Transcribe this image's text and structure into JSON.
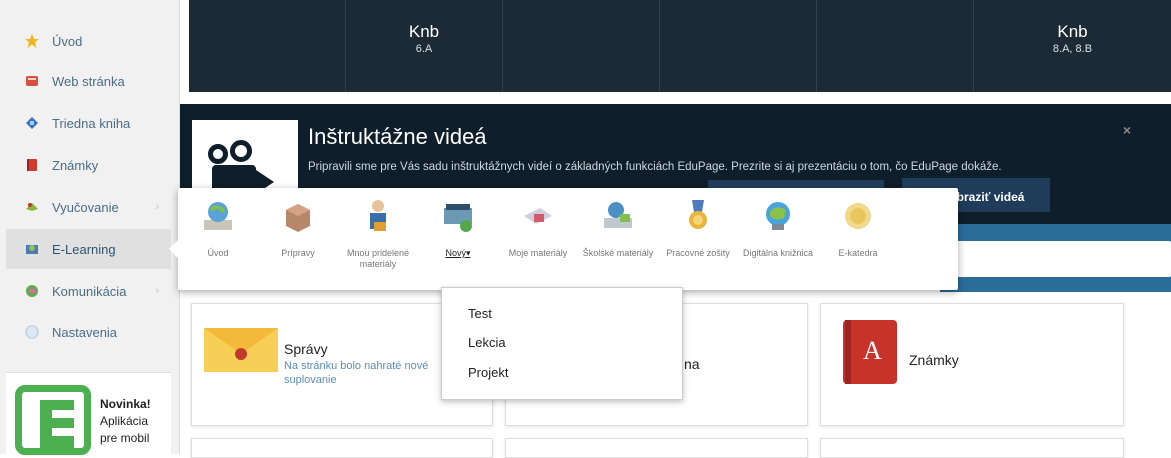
{
  "sidebar": {
    "items": [
      {
        "label": "Úvod",
        "icon": "star-icon",
        "color": "#f2b51c"
      },
      {
        "label": "Web stránka",
        "icon": "web-icon",
        "color": "#d7503c"
      },
      {
        "label": "Triedna kniha",
        "icon": "class-book-icon",
        "color": "#3c6fc0"
      },
      {
        "label": "Známky",
        "icon": "grades-book-icon",
        "color": "#d13a2f"
      },
      {
        "label": "Vyučovanie",
        "icon": "teaching-icon",
        "color": "#8ab53e"
      },
      {
        "label": "E-Learning",
        "icon": "elearning-icon",
        "color": "#4b7bb3"
      },
      {
        "label": "Komunikácia",
        "icon": "communication-icon",
        "color": "#6aa84f"
      },
      {
        "label": "Nastavenia",
        "icon": "settings-icon",
        "color": "#bcd4e6"
      }
    ],
    "novinka": {
      "title": "Novinka!",
      "line2": "Aplikácia",
      "line3": "pre mobil",
      "brand_color": "#4caf50"
    }
  },
  "timetable": {
    "cells": [
      {
        "name": "",
        "class": ""
      },
      {
        "name": "Knb",
        "class": "6.A"
      },
      {
        "name": "",
        "class": ""
      },
      {
        "name": "",
        "class": ""
      },
      {
        "name": "",
        "class": ""
      },
      {
        "name": "Knb",
        "class": "8.A, 8.B"
      }
    ]
  },
  "banner": {
    "title": "Inštruktážne videá",
    "description": "Pripravili sme pre Vás sadu inštruktážnych videí o základných funkciách EduPage. Prezrite si aj prezentáciu o tom, čo EduPage dokáže.",
    "close": "×",
    "button_videos": "Zobraziť videá"
  },
  "elearning_menu": {
    "items": [
      {
        "label": "Úvod",
        "icon": "globe-book-icon"
      },
      {
        "label": "Prípravy",
        "icon": "box-icon"
      },
      {
        "label": "Mnou pridelené materiály",
        "icon": "teacher-icon"
      },
      {
        "label": "Nový▾",
        "icon": "new-material-icon"
      },
      {
        "label": "Moje materiály",
        "icon": "materials-icon"
      },
      {
        "label": "Školské materiály",
        "icon": "school-materials-icon"
      },
      {
        "label": "Pracovné zošity",
        "icon": "medal-icon"
      },
      {
        "label": "Digitálna knižnica",
        "icon": "digital-library-icon"
      },
      {
        "label": "E-katedra",
        "icon": "coin-icon"
      }
    ],
    "dropdown": [
      "Test",
      "Lekcia",
      "Projekt"
    ]
  },
  "cards": {
    "spravy": {
      "title": "Správy",
      "desc": "Na stránku bolo nahraté nové suplovanie"
    },
    "middle": {
      "title_fragment": "na"
    },
    "znamky": {
      "title": "Známky",
      "icon_letter": "A"
    }
  },
  "colors": {
    "sidebar_text": "#4a6d87",
    "dark": "#1c2a36",
    "accent_blue": "#2b6d9a",
    "link": "#5b8db5"
  }
}
